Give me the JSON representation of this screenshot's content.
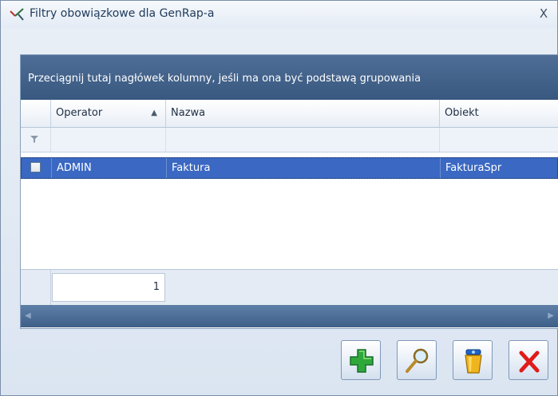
{
  "window": {
    "title": "Filtry obowiązkowe dla GenRap-a",
    "close_label": "X"
  },
  "grid": {
    "group_panel_text": "Przeciągnij tutaj nagłówek kolumny, jeśli ma ona być podstawą grupowania",
    "columns": [
      "Operator",
      "Nazwa",
      "Obiekt"
    ],
    "sort": {
      "column": "Operator",
      "direction": "ascending"
    },
    "rows": [
      {
        "checked": false,
        "operator": "ADMIN",
        "nazwa": "Faktura",
        "obiekt": "FakturaSpr",
        "selected": true
      }
    ],
    "footer_count": "1"
  },
  "toolbar": {
    "buttons": [
      {
        "name": "add-button",
        "icon": "plus-icon"
      },
      {
        "name": "preview-button",
        "icon": "magnifier-icon"
      },
      {
        "name": "delete-button",
        "icon": "trash-icon"
      },
      {
        "name": "close-button",
        "icon": "red-x-icon"
      }
    ]
  },
  "colors": {
    "header_blue": "#3f5f89",
    "selection_blue": "#3a68c2",
    "add_green": "#2fa83b",
    "close_red": "#e01b1b"
  }
}
